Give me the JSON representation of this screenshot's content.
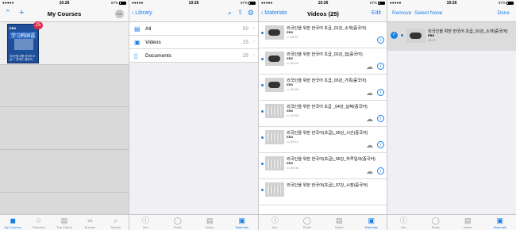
{
  "status": {
    "carrier": "●●●●● ",
    "time": "10:26",
    "battery": "87%"
  },
  "screen1": {
    "nav": {
      "left_icon": "chevron-up",
      "plus": "+",
      "title": "My Courses",
      "avatar": "KA"
    },
    "book": {
      "brand": "EBS",
      "title": "学习韩国语",
      "subtitle": "외국인을 위한 한국어 초급 1 · 한국어 / 중국어",
      "badge": "25"
    },
    "tabs": [
      {
        "label": "My Courses",
        "icon": "◼"
      },
      {
        "label": "Featured",
        "icon": "☆"
      },
      {
        "label": "Top Charts",
        "icon": "▤"
      },
      {
        "label": "Browse",
        "icon": "∞"
      },
      {
        "label": "Search",
        "icon": "⌕"
      }
    ]
  },
  "screen2": {
    "nav": {
      "back": "Library"
    },
    "rows": [
      {
        "label": "All",
        "count": "50",
        "icon": "▤"
      },
      {
        "label": "Videos",
        "count": "25",
        "icon": "▣"
      },
      {
        "label": "Documents",
        "count": "25",
        "icon": "▯"
      }
    ],
    "tabs": [
      {
        "label": "Info",
        "icon": "ⓘ"
      },
      {
        "label": "Posts",
        "icon": "◯"
      },
      {
        "label": "Notes",
        "icon": "▤"
      },
      {
        "label": "Materials",
        "icon": "▣"
      }
    ]
  },
  "screen3": {
    "nav": {
      "back": "Materials",
      "title": "Videos (25)",
      "right": "Edit"
    },
    "videos": [
      {
        "title": "외국인을 위한 한국어 초급_01강_소개(중국어)",
        "source": "EBS",
        "duration": "28:57"
      },
      {
        "title": "외국인을 위한 한국어 초급_02강_집(중국어)",
        "source": "EBS",
        "duration": "30:24"
      },
      {
        "title": "외국인을 위한 한국어 초급_03강_가족(중국어)",
        "source": "EBS",
        "duration": "30:29"
      },
      {
        "title": "외국인을 위한 한국어 초급 _04강_날짜(중국어)",
        "source": "EBS",
        "duration": "29:59"
      },
      {
        "title": "외국인을 위한 한국어(초급)_05강_시간(중국어)",
        "source": "EBS",
        "duration": "30:12"
      },
      {
        "title": "외국인을 위한 한국어(초급)_06강_하루일과(중국어)",
        "source": "EBS",
        "duration": "30:08"
      },
      {
        "title": "외국인을 위한 한국어(초급)_07강_시장(중국어)",
        "source": "",
        "duration": ""
      }
    ]
  },
  "screen4": {
    "nav": {
      "remove": "Remove",
      "select_none": "Select None",
      "done": "Done"
    },
    "selected": {
      "title": "외국인을 위한 한국어 초급_01강_소개(중국어)",
      "source": "EBS",
      "duration": "28:57"
    }
  }
}
